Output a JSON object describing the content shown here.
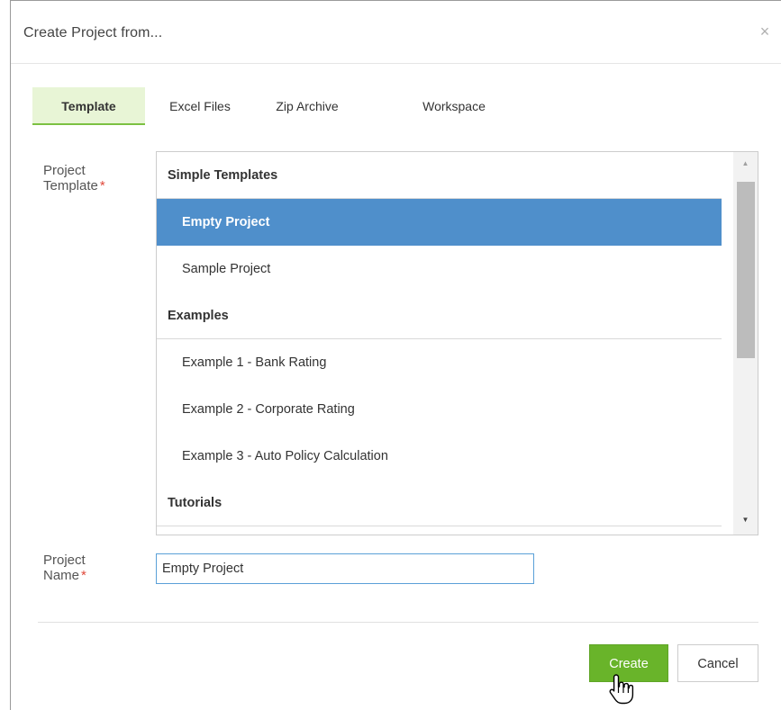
{
  "dialog": {
    "title": "Create Project from...",
    "close_label": "×"
  },
  "tabs": [
    {
      "label": "Template",
      "active": true
    },
    {
      "label": "Excel Files",
      "active": false
    },
    {
      "label": "Zip Archive",
      "active": false
    },
    {
      "label": "Workspace",
      "active": false
    }
  ],
  "form": {
    "template_label_line1": "Project",
    "template_label_line2": "Template",
    "name_label_line1": "Project",
    "name_label_line2": "Name",
    "required_mark": "*",
    "project_name_value": "Empty Project"
  },
  "template_list": {
    "groups": [
      {
        "label": "Simple Templates",
        "items": [
          "Empty Project",
          "Sample Project"
        ]
      },
      {
        "label": "Examples",
        "items": [
          "Example 1 - Bank Rating",
          "Example 2 - Corporate Rating",
          "Example 3 - Auto Policy Calculation"
        ]
      },
      {
        "label": "Tutorials",
        "items": []
      }
    ],
    "selected": "Empty Project",
    "scroll_up": "▲",
    "scroll_down": "▼"
  },
  "buttons": {
    "create": "Create",
    "cancel": "Cancel"
  },
  "colors": {
    "accent_green": "#69b42a",
    "tab_active_bg": "#e8f5d6",
    "selection_blue": "#4f8fcb",
    "required_red": "#e0483b"
  }
}
